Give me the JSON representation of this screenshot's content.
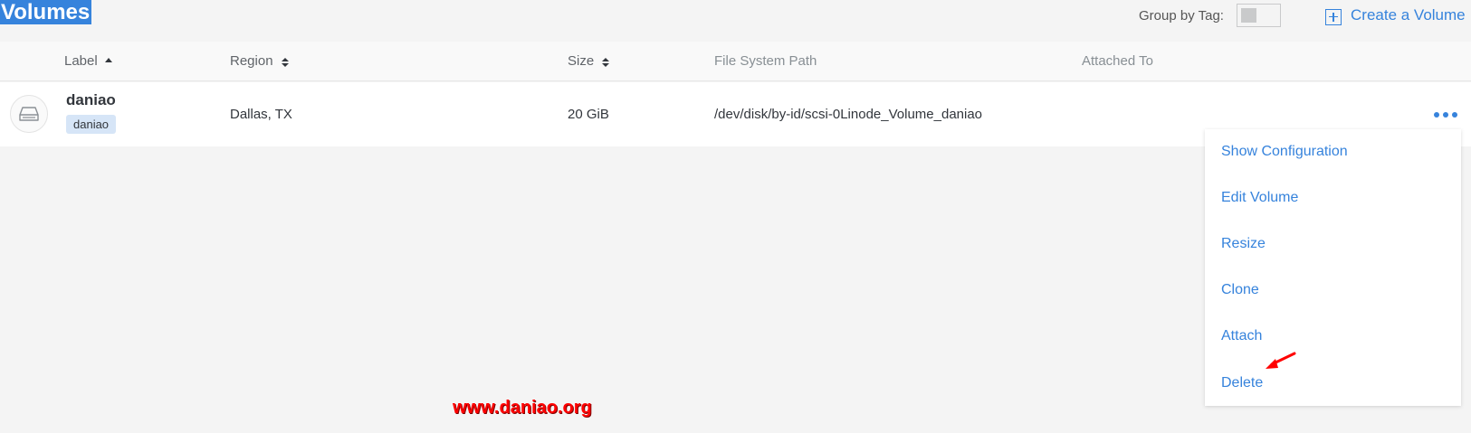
{
  "header": {
    "title": "Volumes",
    "group_by_label": "Group by Tag:",
    "create_label": "Create a Volume"
  },
  "table": {
    "columns": [
      {
        "label": "Label",
        "sort": "asc"
      },
      {
        "label": "Region",
        "sort": "both"
      },
      {
        "label": "Size",
        "sort": "both"
      },
      {
        "label": "File System Path",
        "sort": "none"
      },
      {
        "label": "Attached To",
        "sort": "none"
      }
    ],
    "rows": [
      {
        "label": "daniao",
        "tag": "daniao",
        "region": "Dallas, TX",
        "size": "20 GiB",
        "path": "/dev/disk/by-id/scsi-0Linode_Volume_daniao",
        "attached_to": ""
      }
    ]
  },
  "menu": {
    "items": [
      {
        "label": "Show Configuration"
      },
      {
        "label": "Edit Volume"
      },
      {
        "label": "Resize"
      },
      {
        "label": "Clone"
      },
      {
        "label": "Attach"
      },
      {
        "label": "Delete"
      }
    ]
  },
  "watermark": "www.daniao.org",
  "colors": {
    "accent": "#3683dc",
    "title_highlight": "#3683dc",
    "tag_bg": "#d6e5f7",
    "annotation": "#ff0000"
  },
  "icons": {
    "row": "hard-drive-icon",
    "create": "plus-box-icon",
    "more": "more-horizontal-icon",
    "annotation": "red-arrow-icon"
  }
}
